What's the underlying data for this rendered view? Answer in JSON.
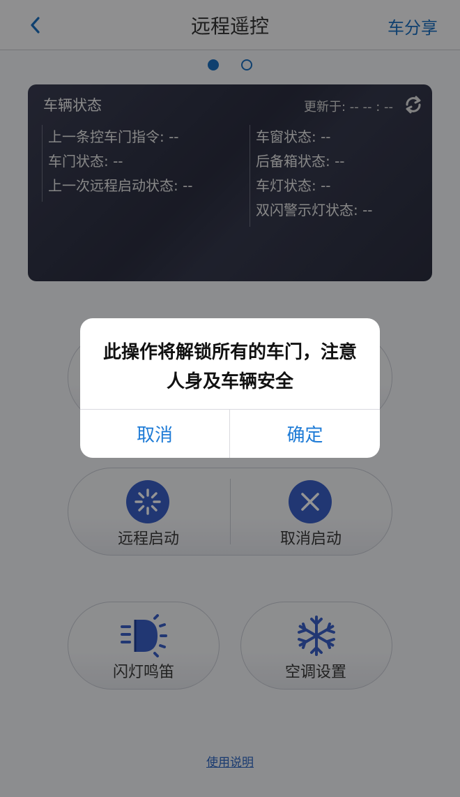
{
  "header": {
    "title": "远程遥控",
    "share_label": "车分享"
  },
  "status_card": {
    "title": "车辆状态",
    "updated_label": "更新于: -- -- : --",
    "left_rows": [
      "上一条控车门指令: --",
      "车门状态: --",
      "上一次远程启动状态: --"
    ],
    "right_rows": [
      "车窗状态: --",
      "后备箱状态: --",
      "车灯状态: --",
      "双闪警示灯状态: --"
    ]
  },
  "controls": {
    "remote_start": "远程启动",
    "cancel_start": "取消启动",
    "flash_horn": "闪灯鸣笛",
    "ac_settings": "空调设置"
  },
  "help_link": "使用说明",
  "dialog": {
    "message": "此操作将解锁所有的车门，注意人身及车辆安全",
    "cancel": "取消",
    "confirm": "确定"
  },
  "colors": {
    "accent": "#1b6fc0",
    "icon_blue": "#3a5fc7",
    "card_bg": "#2b2e40"
  }
}
